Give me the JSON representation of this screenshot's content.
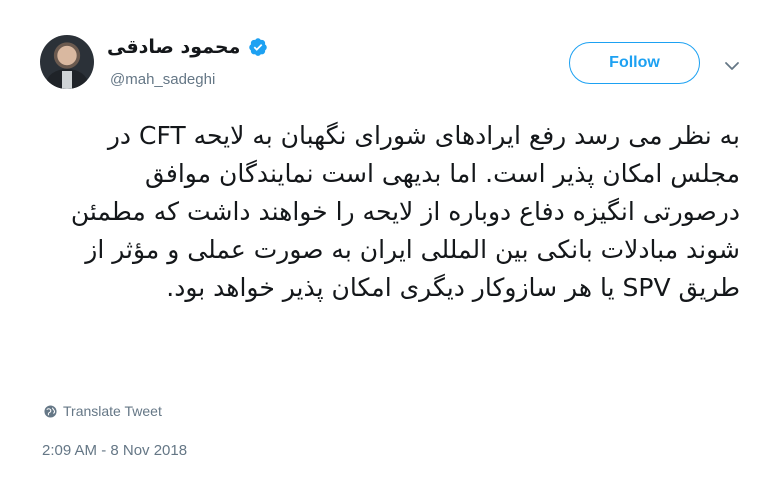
{
  "user": {
    "display_name": "محمود صادقی",
    "handle": "@mah_sadeghi",
    "verified": true
  },
  "follow_button": {
    "label": "Follow"
  },
  "tweet": {
    "text": "به نظر می رسد رفع ایرادهای شورای نگهبان به لایحه CFT در مجلس امکان پذیر است. اما بدیهی است نمایندگان موافق درصورتی انگیزه دفاع دوباره از لایحه را خواهند داشت که مطمئن شوند مبادلات بانکی بین المللی ایران به صورت عملی و مؤثر از طریق SPV یا هر سازوکار دیگری امکان پذیر خواهد بود.",
    "translate_label": "Translate Tweet",
    "timestamp": "2:09 AM - 8 Nov 2018"
  },
  "icons": {
    "verified": "verified-badge-icon",
    "caret": "chevron-down-icon",
    "translate": "globe-icon"
  },
  "colors": {
    "accent": "#1da1f2",
    "secondary_text": "#657786",
    "primary_text": "#14171a"
  }
}
